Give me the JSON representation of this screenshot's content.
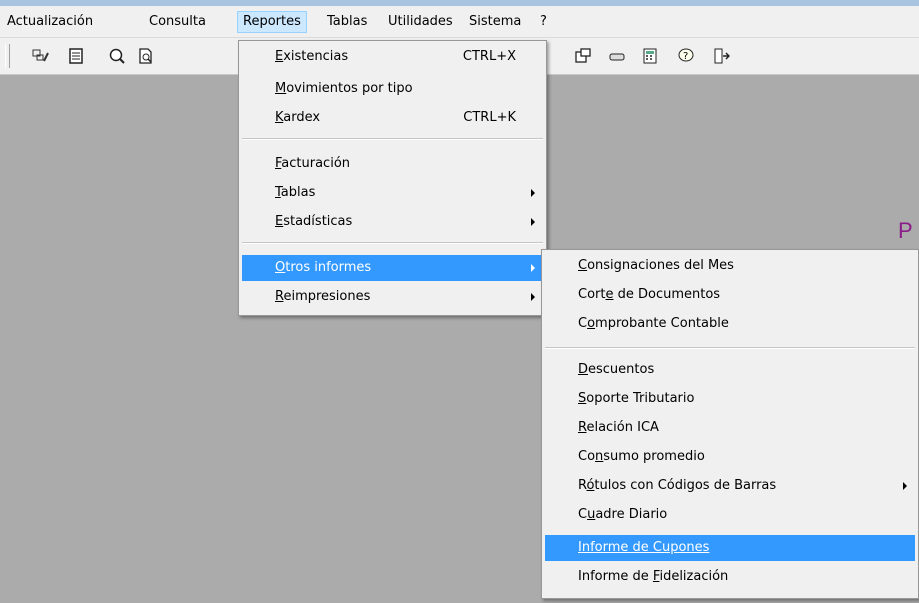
{
  "menubar": {
    "items": [
      {
        "label": "Actualización"
      },
      {
        "label": "Consulta"
      },
      {
        "label": "Reportes"
      },
      {
        "label": "Tablas"
      },
      {
        "label": "Utilidades"
      },
      {
        "label": "Sistema"
      },
      {
        "label": "?"
      }
    ]
  },
  "toolbar": {
    "icons": [
      "edit-form-icon",
      "notepad-icon",
      "zoom-icon",
      "print-preview-icon",
      "window-icon",
      "drive-icon",
      "calculator-icon",
      "help-icon",
      "exit-door-icon"
    ]
  },
  "background": {
    "partial_text": "P"
  },
  "reportes_menu": {
    "items": [
      {
        "pre": "",
        "key": "E",
        "post": "xistencias",
        "shortcut": "CTRL+X"
      },
      {
        "pre": "",
        "key": "M",
        "post": "ovimientos por tipo",
        "shortcut": ""
      },
      {
        "pre": "",
        "key": "K",
        "post": "ardex",
        "shortcut": "CTRL+K"
      },
      {
        "pre": "",
        "key": "F",
        "post": "acturación",
        "shortcut": ""
      },
      {
        "pre": "",
        "key": "T",
        "post": "ablas",
        "shortcut": ""
      },
      {
        "pre": "",
        "key": "E",
        "post": "stadísticas",
        "shortcut": ""
      },
      {
        "pre": "",
        "key": "O",
        "post": "tros informes",
        "shortcut": ""
      },
      {
        "pre": "",
        "key": "R",
        "post": "eimpresiones",
        "shortcut": ""
      }
    ]
  },
  "otros_menu": {
    "items": [
      {
        "pre": "",
        "key": "C",
        "post": "onsignaciones del Mes"
      },
      {
        "pre": "Cort",
        "key": "e",
        "post": " de Documentos"
      },
      {
        "pre": "C",
        "key": "o",
        "post": "mprobante Contable"
      },
      {
        "pre": "",
        "key": "D",
        "post": "escuentos"
      },
      {
        "pre": "",
        "key": "S",
        "post": "oporte Tributario"
      },
      {
        "pre": "",
        "key": "R",
        "post": "elación ICA"
      },
      {
        "pre": "Co",
        "key": "n",
        "post": "sumo promedio"
      },
      {
        "pre": "R",
        "key": "ó",
        "post": "tulos con Códigos de Barras"
      },
      {
        "pre": "C",
        "key": "u",
        "post": "adre Diario"
      },
      {
        "pre": "",
        "key": "I",
        "post": "nforme de Cupones"
      },
      {
        "pre": "Informe de ",
        "key": "F",
        "post": "idelización"
      }
    ]
  },
  "colors": {
    "highlight": "#3399ff",
    "menu_bg": "#f0f0f0",
    "desktop": "#ababab"
  }
}
